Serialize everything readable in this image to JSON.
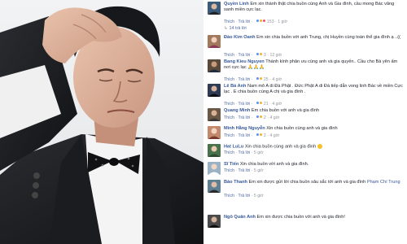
{
  "comments": [
    {
      "name": "Quyền Linh",
      "text": "Em xin thành thật chia buồn cùng Anh và Gia đình, cầu mong Bác vãng sanh miền cực lạc.",
      "like": "Thích",
      "reply": "Trả lời",
      "time": "1 giờ",
      "reactions": "153",
      "reply_count": "14 trả lời",
      "avatar_color": "#3c5b7a"
    },
    {
      "name": "Đào Kim Oanh",
      "text": "Em xin chia buồn với anh Trung, chị Huyền cùng toàn thể gia đình ạ ..((",
      "like": "Thích",
      "reply": "Trả lời",
      "time": "12 giờ",
      "reactions": "3",
      "avatar_color": "#a17a5b"
    },
    {
      "name": "Bang Kieu Nguyen",
      "text": "Thành kính phân ưu cùng anh và gia quyến.. Cầu cho Bà yên ấm nơi cực lạc",
      "like": "Thích",
      "reply": "Trả lời",
      "time": "4 giờ",
      "reactions": "25",
      "avatar_color": "#5a4a3a"
    },
    {
      "name": "Lê Bá Anh",
      "text": "Nam mô A di Đà Phật . Đức Phật A di Đà tiếp dẫn vong linh Bác về miền Cực lạc . E chia buồn cùng A chị và gia đình .",
      "like": "Thích",
      "reply": "Trả lời",
      "time": "4 giờ",
      "reactions": "21",
      "avatar_color": "#2e3b55"
    },
    {
      "name": "Quang Minh",
      "text": "Em chia buồn với anh và gia đình",
      "like": "Thích",
      "reply": "Trả lời",
      "time": "4 giờ",
      "reactions": "2",
      "avatar_color": "#6b5844"
    },
    {
      "name": "Minh Hằng Nguyễn",
      "text": "Xin chia buồn cùng anh và gia đình",
      "like": "Thích",
      "reply": "Trả lời",
      "time": "4 giờ",
      "reactions": "2",
      "avatar_color": "#c28a6a"
    },
    {
      "name": "Hat LuLu",
      "text": "Xin chia buồn cùng anh và gia đình",
      "like": "Thích",
      "reply": "Trả lời",
      "time": "5 giờ",
      "avatar_color": "#48724a"
    },
    {
      "name": "Sĩ Tiến",
      "text": "Xin chia buồn với anh và gia đình.",
      "like": "Thích",
      "reply": "Trả lời",
      "time": "5 giờ",
      "avatar_color": "#9ab2c6"
    },
    {
      "name": "Bảo Thanh",
      "text": "Em xin được gửi lời chia buồn sâu sắc tới anh và gia đình",
      "tag": "Phạm Chí Trung",
      "like": "Thích",
      "reply": "Trả lời",
      "time": "5 giờ",
      "avatar_color": "#5f7f93"
    },
    {
      "name": "Ngô Quân Anh",
      "text": "Em xin được chia buồn với anh và gia đình!",
      "avatar_color": "#4a4a4a"
    }
  ],
  "separator": "·"
}
